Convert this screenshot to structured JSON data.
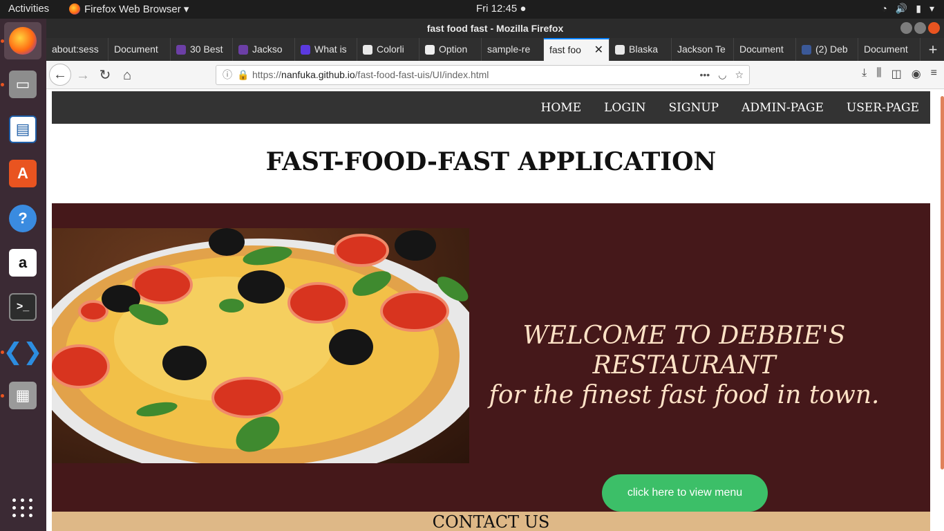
{
  "system": {
    "activities": "Activities",
    "app_menu": "Firefox Web Browser ▾",
    "clock": "Fri 12:45 ●"
  },
  "window": {
    "title": "fast food fast - Mozilla Firefox"
  },
  "tabs": [
    {
      "label": "about:sess",
      "fav": "none"
    },
    {
      "label": "Document",
      "fav": "none"
    },
    {
      "label": "30 Best",
      "fav": "colorlib"
    },
    {
      "label": "Jackso",
      "fav": "colorlib"
    },
    {
      "label": "What is",
      "fav": "triangle"
    },
    {
      "label": "Colorli",
      "fav": "wordpress"
    },
    {
      "label": "Option",
      "fav": "github"
    },
    {
      "label": "sample-re",
      "fav": "none"
    },
    {
      "label": "fast foo",
      "fav": "none",
      "active": true
    },
    {
      "label": "Blaska",
      "fav": "wordpress"
    },
    {
      "label": "Jackson Te",
      "fav": "none"
    },
    {
      "label": "Document",
      "fav": "none"
    },
    {
      "label": "(2) Deb",
      "fav": "facebook"
    },
    {
      "label": "Document",
      "fav": "none"
    }
  ],
  "url": {
    "prefix": "https://",
    "host": "nanfuka.github.io",
    "path": "/fast-food-fast-uis/UI/index.html"
  },
  "site": {
    "nav": [
      "HOME",
      "LOGIN",
      "SIGNUP",
      "ADMIN-PAGE",
      "USER-PAGE"
    ],
    "title": "FAST-FOOD-FAST APPLICATION",
    "welcome_line1": "WELCOME TO DEBBIE'S",
    "welcome_line2": "RESTAURANT",
    "welcome_line3": "for the finest fast food in town.",
    "menu_button": "click here to view menu",
    "contact": "CONTACT US"
  },
  "colors": {
    "nav_bg": "#333333",
    "hero_bg": "#45181a",
    "button": "#3cbf68",
    "contact_bg": "#deb887"
  }
}
